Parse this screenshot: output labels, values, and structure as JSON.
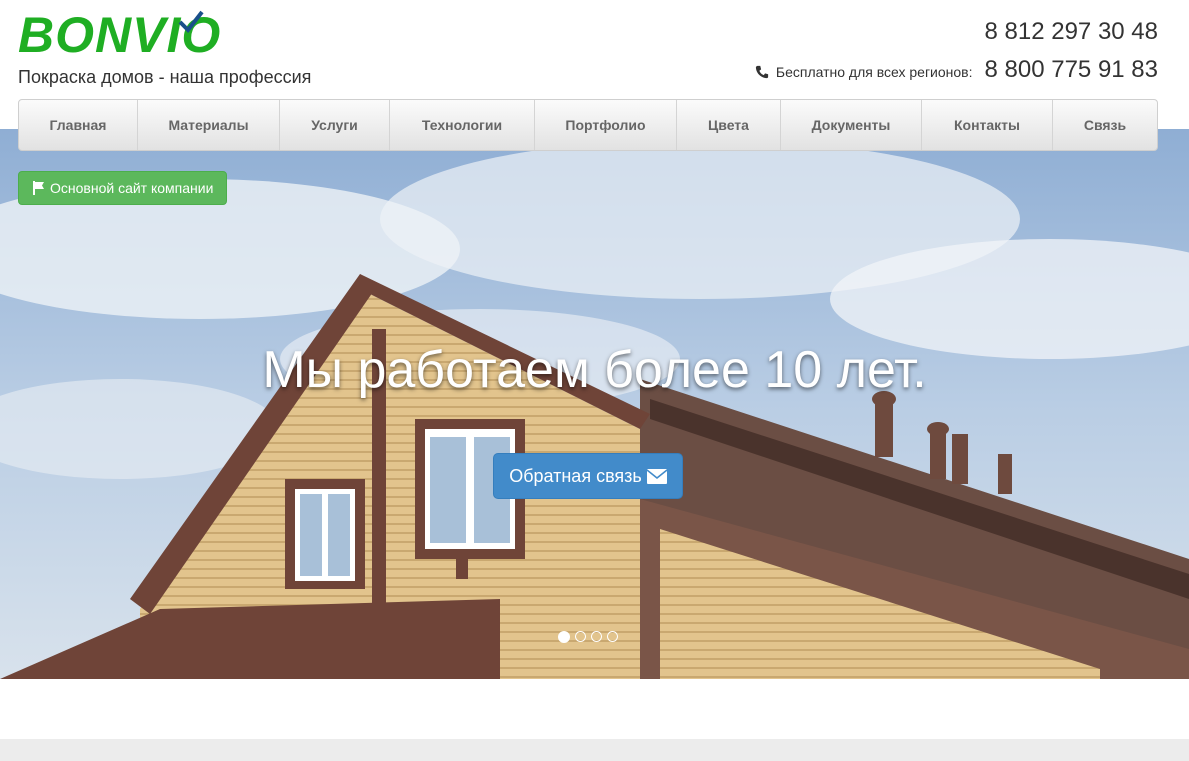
{
  "header": {
    "logo": "BONVIO",
    "tagline": "Покраска домов - наша профессия",
    "phone_primary": "8 812 297 30 48",
    "free_label": "Бесплатно для всех регионов:",
    "phone_free": "8 800 775 91 83"
  },
  "nav": {
    "items": [
      {
        "label": "Главная"
      },
      {
        "label": "Материалы"
      },
      {
        "label": "Услуги"
      },
      {
        "label": "Технологии"
      },
      {
        "label": "Портфолио"
      },
      {
        "label": "Цвета"
      },
      {
        "label": "Документы"
      },
      {
        "label": "Контакты"
      },
      {
        "label": "Связь"
      }
    ]
  },
  "hero": {
    "company_button": "Основной сайт компании",
    "title": "Мы работаем более 10 лет.",
    "feedback_button": "Обратная связь",
    "slides_total": 4,
    "active_slide": 1
  },
  "colors": {
    "brand_green": "#1fae23",
    "button_green": "#5cb85c",
    "button_blue": "#428bca"
  }
}
